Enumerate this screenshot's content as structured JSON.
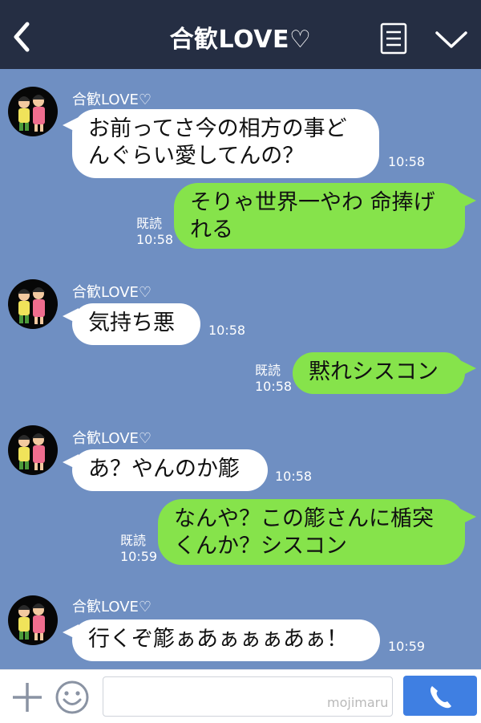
{
  "header": {
    "title": "合歓LOVE♡"
  },
  "messages": [
    {
      "side": "left",
      "sender": "合歓LOVE♡",
      "text": "お前ってさ今の相方の事ど\nんぐらい愛してんの？",
      "time": "10:58"
    },
    {
      "side": "right",
      "text": "そりゃ世界一やわ 命捧げ\nれる",
      "read": "既読",
      "time": "10:58"
    },
    {
      "side": "left",
      "sender": "合歓LOVE♡",
      "text": "気持ち悪",
      "time": "10:58"
    },
    {
      "side": "right",
      "text": "黙れシスコン",
      "read": "既読",
      "time": "10:58"
    },
    {
      "side": "left",
      "sender": "合歓LOVE♡",
      "text": "あ？やんのか簓",
      "time": "10:58"
    },
    {
      "side": "right",
      "text": "なんや？この簓さんに楯突\nくんか？シスコン",
      "read": "既読",
      "time": "10:59"
    },
    {
      "side": "left",
      "sender": "合歓LOVE♡",
      "text": "行くぞ簓ぁあぁぁぁあぁ！",
      "time": "10:59"
    }
  ],
  "input": {
    "placeholder": "",
    "watermark": "mojimaru"
  },
  "colors": {
    "header_bg": "#252e43",
    "chat_bg": "#6f8fc2",
    "own_bubble": "#86e34b",
    "other_bubble": "#ffffff",
    "call_button": "#3f7fe2"
  },
  "icons": {
    "back": "chevron-left-icon",
    "menu": "note-icon",
    "collapse": "chevron-down-icon",
    "plus": "plus-icon",
    "emoji": "smiley-icon",
    "call": "phone-icon"
  }
}
